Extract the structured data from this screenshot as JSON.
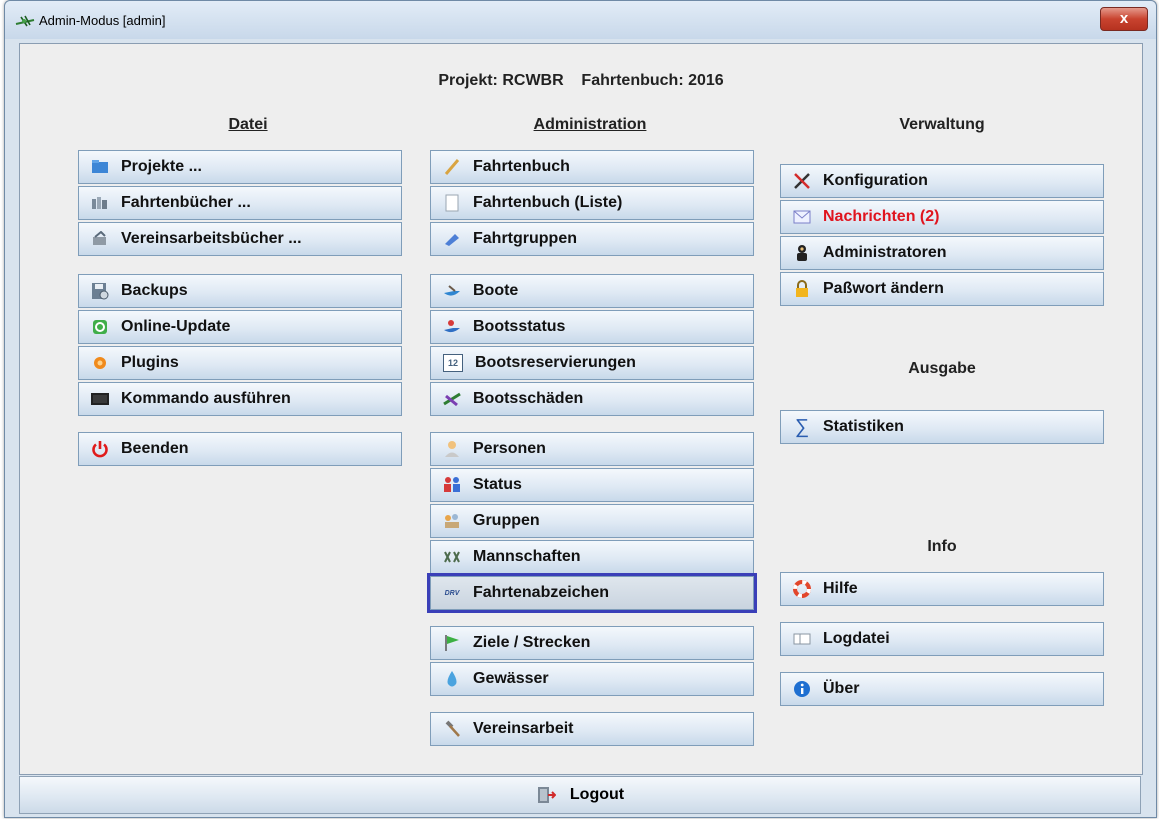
{
  "window": {
    "title": "Admin-Modus [admin]",
    "close_label": "x"
  },
  "header": {
    "project": "Projekt: RCWBR    Fahrtenbuch: 2016"
  },
  "headings": {
    "datei": "Datei",
    "administration": "Administration",
    "verwaltung": "Verwaltung",
    "ausgabe": "Ausgabe",
    "info": "Info"
  },
  "buttons": {
    "projekte": "Projekte ...",
    "fahrtenbuecher": "Fahrtenbücher ...",
    "vereinsarbeitsbuecher": "Vereinsarbeitsbücher ...",
    "backups": "Backups",
    "online_update": "Online-Update",
    "plugins": "Plugins",
    "kommando": "Kommando ausführen",
    "beenden": "Beenden",
    "fahrtenbuch": "Fahrtenbuch",
    "fahrtenbuch_liste": "Fahrtenbuch (Liste)",
    "fahrtgruppen": "Fahrtgruppen",
    "boote": "Boote",
    "bootsstatus": "Bootsstatus",
    "bootsreservierungen": "Bootsreservierungen",
    "bootsschaeden": "Bootsschäden",
    "personen": "Personen",
    "status": "Status",
    "gruppen": "Gruppen",
    "mannschaften": "Mannschaften",
    "fahrtenabzeichen": "Fahrtenabzeichen",
    "ziele": "Ziele / Strecken",
    "gewaesser": "Gewässer",
    "vereinsarbeit": "Vereinsarbeit",
    "konfiguration": "Konfiguration",
    "nachrichten": "Nachrichten (2)",
    "administratoren": "Administratoren",
    "passwort": "Paßwort ändern",
    "statistiken": "Statistiken",
    "hilfe": "Hilfe",
    "logdatei": "Logdatei",
    "ueber": "Über",
    "logout": "Logout"
  },
  "icon_text": {
    "calendar": "12",
    "drv": "DRV"
  },
  "colors": {
    "window_bg": "#d8e3ee",
    "panel_bg": "#eeeeee",
    "button_border": "#7f9db9",
    "focus_ring": "#3a3fb8",
    "alert_text": "#e0141e"
  }
}
